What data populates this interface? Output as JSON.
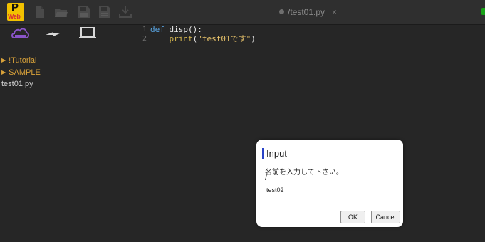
{
  "app": {
    "logo_letter": "P",
    "logo_sub": "Web"
  },
  "toolbar": {
    "icons": [
      "new-file-icon",
      "open-folder-icon",
      "save-icon",
      "save-as-icon",
      "download-icon"
    ]
  },
  "tab": {
    "label": "/test01.py",
    "close": "×"
  },
  "sidebar": {
    "icons": [
      "cloud-icon",
      "transfer-icon",
      "laptop-icon"
    ],
    "tree": [
      {
        "type": "folder",
        "label": "!Tutorial"
      },
      {
        "type": "folder",
        "label": "SAMPLE"
      },
      {
        "type": "file",
        "label": "test01.py"
      }
    ]
  },
  "editor": {
    "line_numbers": [
      "1",
      "2"
    ],
    "lines": [
      {
        "kw": "def",
        "fn": " disp",
        "rest": "():"
      },
      {
        "indent": "    ",
        "builtin": "print",
        "open": "(",
        "str": "\"test01です\"",
        "close": ")"
      }
    ]
  },
  "dialog": {
    "title": "Input",
    "message": "名前を入力して下さい。",
    "path": "/",
    "input_value": "test02",
    "ok_label": "OK",
    "cancel_label": "Cancel"
  },
  "colors": {
    "accent": "#2a44c8",
    "cloud": "#8a54c8",
    "folder": "#d9a23a",
    "status": "#19a319"
  }
}
